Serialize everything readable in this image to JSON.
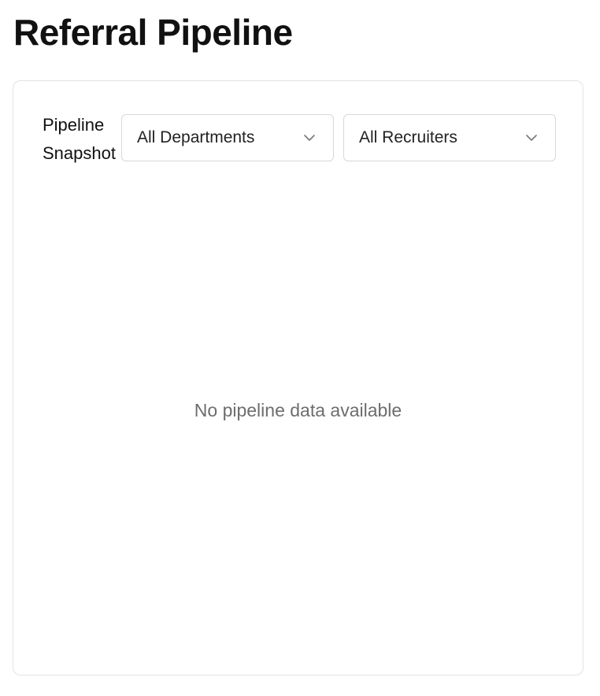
{
  "header": {
    "title": "Referral Pipeline"
  },
  "card": {
    "title": "Pipeline Snapshot",
    "filters": {
      "department": {
        "selected": "All Departments",
        "icon": "chevron-down-icon"
      },
      "recruiter": {
        "selected": "All Recruiters",
        "icon": "chevron-down-icon"
      }
    },
    "empty_state": "No pipeline data available"
  },
  "colors": {
    "title_text": "#111111",
    "muted_text": "#6d6d6d",
    "card_border": "#e3e3e3",
    "select_border": "#d8d8d8"
  }
}
